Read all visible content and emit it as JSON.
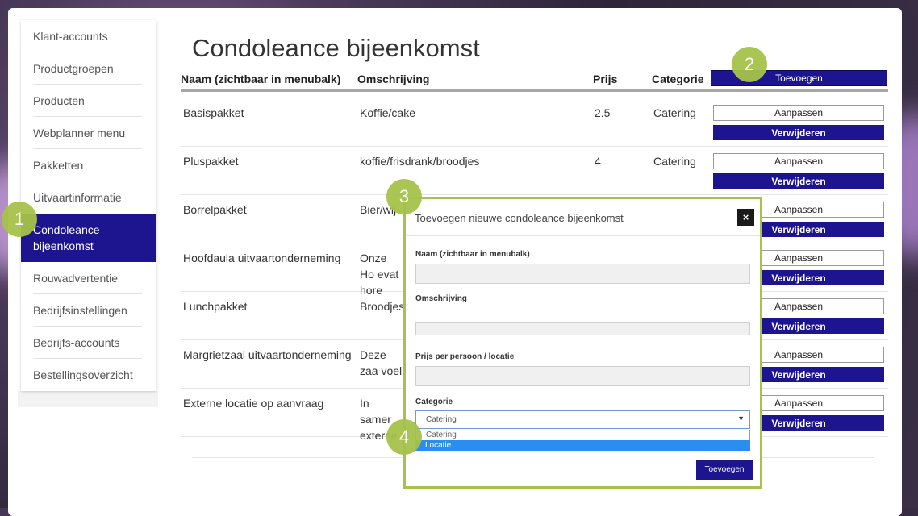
{
  "sidebar": {
    "items": [
      {
        "label": "Klant-accounts",
        "active": false
      },
      {
        "label": "Productgroepen",
        "active": false
      },
      {
        "label": "Producten",
        "active": false
      },
      {
        "label": "Webplanner menu",
        "active": false
      },
      {
        "label": "Pakketten",
        "active": false
      },
      {
        "label": "Uitvaartinformatie",
        "active": false
      },
      {
        "label": "Condoleance bijeenkomst",
        "active": true
      },
      {
        "label": "Rouwadvertentie",
        "active": false
      },
      {
        "label": "Bedrijfsinstellingen",
        "active": false
      },
      {
        "label": "Bedrijfs-accounts",
        "active": false
      },
      {
        "label": "Bestellingsoverzicht",
        "active": false
      }
    ]
  },
  "main": {
    "title": "Condoleance bijeenkomst",
    "columns": {
      "name": "Naam (zichtbaar in menubalk)",
      "description": "Omschrijving",
      "price": "Prijs",
      "category": "Categorie"
    },
    "add_button": "Toevoegen",
    "rows": [
      {
        "name": "Basispakket",
        "description": "Koffie/cake",
        "price": "2.5",
        "category": "Catering"
      },
      {
        "name": "Pluspakket",
        "description": "koffie/frisdrank/broodjes",
        "price": "4",
        "category": "Catering"
      },
      {
        "name": "Borrelpakket",
        "description": "Bier/wij",
        "price": "",
        "category": ""
      },
      {
        "name": "Hoofdaula uitvaartonderneming",
        "description": "Onze Ho evat hore",
        "price": "",
        "category": ""
      },
      {
        "name": "Lunchpakket",
        "description": "Broodjes",
        "price": "",
        "category": ""
      },
      {
        "name": "Margrietzaal uitvaartonderneming",
        "description": "Deze zaa voel",
        "price": "",
        "category": ""
      },
      {
        "name": "Externe locatie op aanvraag",
        "description": "In samer externe",
        "price": "",
        "category": ""
      }
    ],
    "edit_label": "Aanpassen",
    "delete_label": "Verwijderen"
  },
  "modal": {
    "title": "Toevoegen nieuwe condoleance bijeenkomst",
    "close_icon": "×",
    "fields": {
      "name_label": "Naam (zichtbaar in menubalk)",
      "description_label": "Omschrijving",
      "price_label": "Prijs per persoon / locatie",
      "category_label": "Categorie"
    },
    "category_select": {
      "selected": "Catering",
      "options": [
        "Catering",
        "Locatie"
      ],
      "highlighted": "Locatie",
      "arrow": "▼"
    },
    "submit_label": "Toevoegen"
  },
  "annotations": [
    "1",
    "2",
    "3",
    "4"
  ],
  "colors": {
    "accent": "#1d1490",
    "badge": "#a6c24a",
    "highlight": "#2a8df0"
  }
}
